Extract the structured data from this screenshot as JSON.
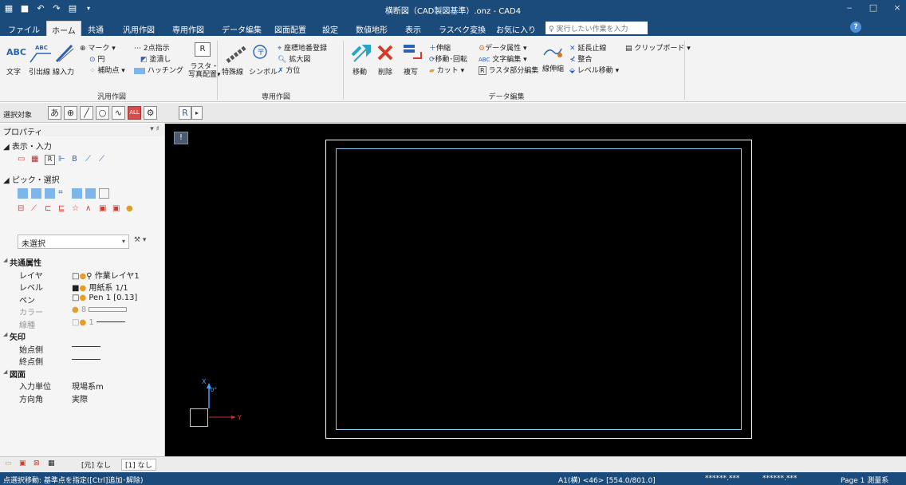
{
  "window": {
    "title": "横断図（CAD製図基準）.onz - CAD4",
    "controls": [
      "‒",
      "□",
      "×"
    ]
  },
  "menu": {
    "tabs": [
      "ファイル",
      "ホーム",
      "共通",
      "汎用作図",
      "専用作図",
      "データ編集",
      "図面配置",
      "設定",
      "数値地形",
      "表示",
      "ラスベク変換",
      "お気に入り"
    ],
    "active": "ホーム",
    "search_placeholder": "実行したい作業を入力",
    "help": "?"
  },
  "ribbon": {
    "general": {
      "text_label": "文字",
      "leader_label": "引出線",
      "line_label": "線入力",
      "mark": "マーク ▾",
      "circle": "円",
      "aux": "補助点 ▾",
      "twopoint": "2点指示",
      "fill": "塗潰し",
      "hatch": "ハッチング",
      "raster": "ラスタ・",
      "photo": "写真配置▾",
      "group_label": "汎用作図"
    },
    "special": {
      "special_line": "特殊線",
      "symbol": "シンボル",
      "coord": "座標地番登録",
      "zoom": "拡大図",
      "direction": "方位",
      "group_label": "専用作図"
    },
    "edit": {
      "move": "移動",
      "delete": "削除",
      "copy": "複写",
      "stretch": "伸縮",
      "moverotate": "移動･回転",
      "cut": "カット ▾",
      "dataattr": "データ属性 ▾",
      "textedit": "文字編集 ▾",
      "rasterpart": "ラスタ部分編集",
      "linestretch": "線伸縮",
      "extend": "延長止線",
      "align": "整合",
      "levelmove": "レベル移動 ▾",
      "clipboard": "クリップボード ▾",
      "group_label": "データ編集"
    }
  },
  "selection_bar": {
    "label": "選択対象",
    "text_btn": "あ",
    "all_btn": "ALL",
    "r_btn": "R"
  },
  "properties": {
    "header": "プロパティ",
    "pin": "▾ ♯",
    "display_input": "表示・入力",
    "pick_select": "ピック・選択",
    "selection": "未選択",
    "common_attr": "共通属性",
    "rows": [
      {
        "k": "レイヤ",
        "v": "作業レイヤ1"
      },
      {
        "k": "レベル",
        "v": "用紙系 1/1"
      },
      {
        "k": "ペン",
        "v": "Pen 1 [0.13]"
      },
      {
        "k": "カラー",
        "v": "8"
      },
      {
        "k": "線種",
        "v": "1"
      }
    ],
    "arrow_cat": "矢印",
    "arrow_start": "始点側",
    "arrow_end": "終点側",
    "drawing_cat": "図面",
    "input_unit_k": "入力単位",
    "input_unit_v": "現場系m",
    "direction_k": "方向角",
    "direction_v": "実際"
  },
  "canvas": {
    "pin_label": "!",
    "axis_x": "X",
    "axis_y": "Y",
    "axis_angle": "0°"
  },
  "bottom_tabs": [
    "[元] なし",
    "[1] なし"
  ],
  "status": {
    "hint": "点選択移動: 基準点を指定([Ctrl]追加･解除)",
    "paper": "A1(横) <46> [554.0/801.0]",
    "coord1": "******.***",
    "coord2": "******.***",
    "page": "Page 1 測量系"
  },
  "colors": {
    "titlebar": "#1b4b7a",
    "ribbon": "#f3f3f3",
    "canvas": "#000000",
    "frame_outer": "#ffffff",
    "frame_inner": "#8fc6f2"
  }
}
